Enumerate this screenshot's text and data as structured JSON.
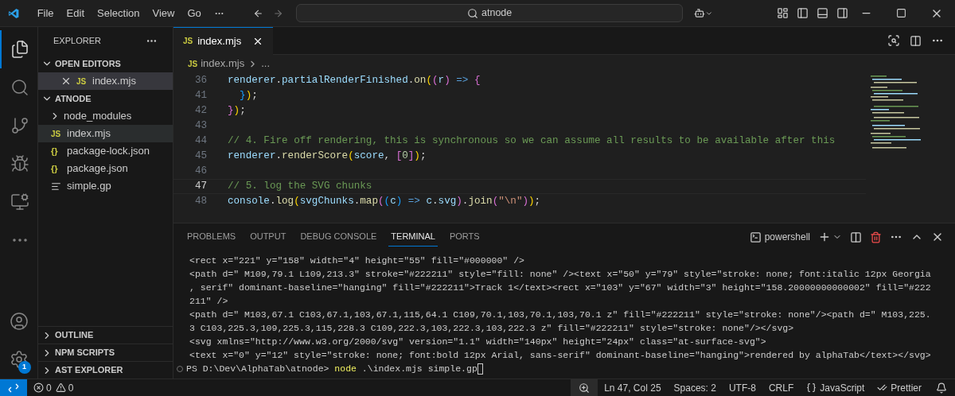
{
  "title_bar": {
    "menu": [
      "File",
      "Edit",
      "Selection",
      "View",
      "Go"
    ],
    "search": {
      "value": "atnode"
    }
  },
  "activity_bar": {
    "items": [
      {
        "kind": "files",
        "selected": true
      },
      {
        "kind": "search",
        "selected": false
      },
      {
        "kind": "source-control",
        "selected": false
      },
      {
        "kind": "run-debug",
        "selected": false
      },
      {
        "kind": "remote",
        "selected": false
      },
      {
        "kind": "more",
        "selected": false
      }
    ],
    "settings_badge": "1"
  },
  "sidebar": {
    "title": "EXPLORER",
    "sections": [
      {
        "label": "OPEN EDITORS",
        "expanded": true,
        "items": [
          {
            "name": "index.mjs",
            "kind": "js",
            "icon_text": "JS",
            "selected": true,
            "closable": true
          }
        ]
      },
      {
        "label": "ATNODE",
        "expanded": true,
        "items": [
          {
            "name": "node_modules",
            "kind": "folder",
            "selected": false
          },
          {
            "name": "index.mjs",
            "kind": "js",
            "icon_text": "JS",
            "selected": true
          },
          {
            "name": "package-lock.json",
            "kind": "json",
            "icon_text": "{}",
            "selected": false
          },
          {
            "name": "package.json",
            "kind": "json",
            "icon_text": "{}",
            "selected": false
          },
          {
            "name": "simple.gp",
            "kind": "text",
            "selected": false
          }
        ]
      }
    ],
    "bottom_sections": [
      {
        "label": "OUTLINE",
        "expanded": false
      },
      {
        "label": "NPM SCRIPTS",
        "expanded": false
      },
      {
        "label": "AST EXPLORER",
        "expanded": false
      }
    ]
  },
  "editor": {
    "tabs": [
      {
        "icon_text": "JS",
        "label": "index.mjs",
        "selected": true
      }
    ],
    "breadcrumb": {
      "icon_text": "JS",
      "file": "index.mjs",
      "rest": "..."
    },
    "lines": [
      {
        "number": "36",
        "current": false,
        "tokens": [
          {
            "kind": "var",
            "text": "renderer"
          },
          {
            "kind": "punct",
            "text": "."
          },
          {
            "kind": "var",
            "text": "partialRenderFinished"
          },
          {
            "kind": "punct",
            "text": "."
          },
          {
            "kind": "fn",
            "text": "on"
          },
          {
            "kind": "b1",
            "text": "("
          },
          {
            "kind": "b2",
            "text": "("
          },
          {
            "kind": "var",
            "text": "r"
          },
          {
            "kind": "b2",
            "text": ")"
          },
          {
            "kind": "keyword",
            "text": " => "
          },
          {
            "kind": "b2",
            "text": "{"
          }
        ]
      },
      {
        "number": "41",
        "current": false,
        "tokens": [
          {
            "kind": "b3",
            "text": "  }"
          },
          {
            "kind": "b1",
            "text": ")"
          },
          {
            "kind": "punct",
            "text": ";"
          }
        ]
      },
      {
        "number": "42",
        "current": false,
        "tokens": [
          {
            "kind": "b2",
            "text": "}"
          },
          {
            "kind": "b1",
            "text": ")"
          },
          {
            "kind": "punct",
            "text": ";"
          }
        ]
      },
      {
        "number": "43",
        "current": false
      },
      {
        "number": "44",
        "current": false,
        "tokens": [
          {
            "kind": "comment",
            "text": "// 4. Fire off rendering, this is synchronous so we can assume all results to be available after this"
          }
        ]
      },
      {
        "number": "45",
        "current": false,
        "tokens": [
          {
            "kind": "var",
            "text": "renderer"
          },
          {
            "kind": "punct",
            "text": "."
          },
          {
            "kind": "fn",
            "text": "renderScore"
          },
          {
            "kind": "b1",
            "text": "("
          },
          {
            "kind": "var",
            "text": "score"
          },
          {
            "kind": "punct",
            "text": ", "
          },
          {
            "kind": "b2",
            "text": "["
          },
          {
            "kind": "number",
            "text": "0"
          },
          {
            "kind": "b2",
            "text": "]"
          },
          {
            "kind": "b1",
            "text": ")"
          },
          {
            "kind": "punct",
            "text": ";"
          }
        ]
      },
      {
        "number": "46",
        "current": false
      },
      {
        "number": "47",
        "current": true,
        "tokens": [
          {
            "kind": "comment",
            "text": "// 5. log the SVG chunks"
          }
        ]
      },
      {
        "number": "48",
        "current": false,
        "tokens": [
          {
            "kind": "var",
            "text": "console"
          },
          {
            "kind": "punct",
            "text": "."
          },
          {
            "kind": "fn",
            "text": "log"
          },
          {
            "kind": "b1",
            "text": "("
          },
          {
            "kind": "var",
            "text": "svgChunks"
          },
          {
            "kind": "punct",
            "text": "."
          },
          {
            "kind": "fn",
            "text": "map"
          },
          {
            "kind": "b2",
            "text": "("
          },
          {
            "kind": "b3",
            "text": "("
          },
          {
            "kind": "var",
            "text": "c"
          },
          {
            "kind": "b3",
            "text": ")"
          },
          {
            "kind": "keyword",
            "text": " => "
          },
          {
            "kind": "var",
            "text": "c"
          },
          {
            "kind": "punct",
            "text": "."
          },
          {
            "kind": "var",
            "text": "svg"
          },
          {
            "kind": "b2",
            "text": ")"
          },
          {
            "kind": "punct",
            "text": "."
          },
          {
            "kind": "fn",
            "text": "join"
          },
          {
            "kind": "b2",
            "text": "("
          },
          {
            "kind": "string",
            "text": "\"\\n\""
          },
          {
            "kind": "b2",
            "text": ")"
          },
          {
            "kind": "b1",
            "text": ")"
          },
          {
            "kind": "punct",
            "text": ";"
          }
        ]
      }
    ]
  },
  "panel": {
    "tabs": [
      {
        "label": "PROBLEMS",
        "selected": false
      },
      {
        "label": "OUTPUT",
        "selected": false
      },
      {
        "label": "DEBUG CONSOLE",
        "selected": false
      },
      {
        "label": "TERMINAL",
        "selected": true
      },
      {
        "label": "PORTS",
        "selected": false
      }
    ],
    "terminal_name": "powershell",
    "terminal_lines": [
      "<rect x=\"221\" y=\"158\" width=\"4\" height=\"55\" fill=\"#000000\" />",
      "<path d=\" M109,79.1 L109,213.3\" stroke=\"#222211\" style=\"fill: none\" /><text x=\"50\" y=\"79\" style=\"stroke: none; font:italic 12px Georgia",
      ", serif\" dominant-baseline=\"hanging\" fill=\"#222211\">Track 1</text><rect x=\"103\" y=\"67\" width=\"3\" height=\"158.20000000000002\" fill=\"#222",
      "211\" />",
      "<path d=\" M103,67.1 C103,67.1,103,67.1,115,64.1 C109,70.1,103,70.1,103,70.1 z\" fill=\"#222211\" style=\"stroke: none\"/><path d=\" M103,225.",
      "3 C103,225.3,109,225.3,115,228.3 C109,222.3,103,222.3,103,222.3 z\" fill=\"#222211\" style=\"stroke: none\"/></svg>",
      "<svg xmlns=\"http://www.w3.org/2000/svg\" version=\"1.1\" width=\"140px\" height=\"24px\" class=\"at-surface-svg\">",
      "<text x=\"0\" y=\"12\" style=\"stroke: none; font:bold 12px Arial, sans-serif\" dominant-baseline=\"hanging\">rendered by alphaTab</text></svg>"
    ],
    "prompt": {
      "path": "PS D:\\Dev\\AlphaTab\\atnode>",
      "command": "node",
      "args": ".\\index.mjs simple.gp"
    }
  },
  "status_bar": {
    "errors": "0",
    "warnings": "0",
    "items": [
      {
        "kind": "plain",
        "text": "Ln 47, Col 25"
      },
      {
        "kind": "plain",
        "text": "Spaces: 2"
      },
      {
        "kind": "plain",
        "text": "UTF-8"
      },
      {
        "kind": "plain",
        "text": "CRLF"
      },
      {
        "kind": "language",
        "text": "JavaScript"
      },
      {
        "kind": "formatter",
        "text": "Prettier"
      }
    ]
  }
}
